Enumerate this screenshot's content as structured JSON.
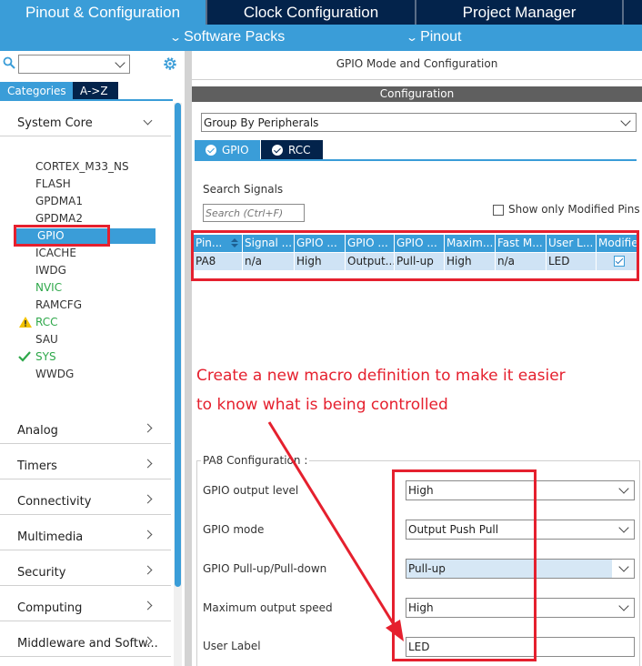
{
  "top_tabs": [
    "Pinout & Configuration",
    "Clock Configuration",
    "Project Manager"
  ],
  "sub_menu": {
    "software_packs": "Software Packs",
    "pinout": "Pinout"
  },
  "left": {
    "cat_tabs": [
      "Categories",
      "A->Z"
    ],
    "system_core": "System Core",
    "peripherals": [
      "CORTEX_M33_NS",
      "FLASH",
      "GPDMA1",
      "GPDMA2",
      "GPIO",
      "ICACHE",
      "IWDG",
      "NVIC",
      "RAMCFG",
      "RCC",
      "SAU",
      "SYS",
      "WWDG"
    ],
    "categories": [
      "Analog",
      "Timers",
      "Connectivity",
      "Multimedia",
      "Security",
      "Computing",
      "Middleware and Softw..."
    ]
  },
  "right": {
    "mode_title": "GPIO Mode and Configuration",
    "config_title": "Configuration",
    "group_by": "Group By Peripherals",
    "tabs": [
      "GPIO",
      "RCC"
    ],
    "search_label": "Search Signals",
    "search_placeholder": "Search (Ctrl+F)",
    "show_modified": "Show only Modified Pins",
    "table": {
      "headers": [
        "Pin...",
        "Signal ...",
        "GPIO ...",
        "GPIO ...",
        "GPIO ...",
        "Maxim...",
        "Fast M...",
        "User L...",
        "Modified"
      ],
      "row": [
        "PA8",
        "n/a",
        "High",
        "Output...",
        "Pull-up",
        "High",
        "n/a",
        "LED"
      ]
    },
    "annotation": [
      "Create a new macro definition to make it easier",
      "to know what is being controlled"
    ],
    "pa8": {
      "title": "PA8 Configuration :",
      "labels": [
        "GPIO output level",
        "GPIO mode",
        "GPIO Pull-up/Pull-down",
        "Maximum output speed",
        "User Label"
      ],
      "values": [
        "High",
        "Output Push Pull",
        "Pull-up",
        "High"
      ],
      "user_label": "LED"
    }
  },
  "colors": {
    "accent": "#3a9dd8",
    "navy": "#03234b",
    "annotation": "#e5202e"
  }
}
